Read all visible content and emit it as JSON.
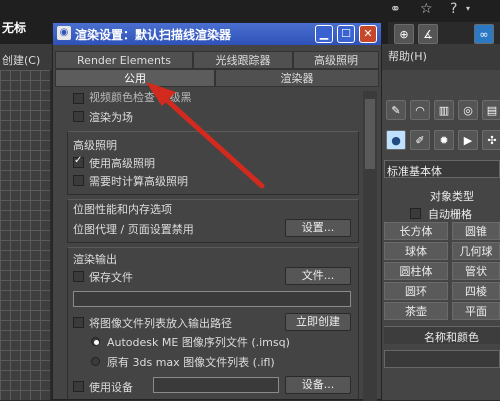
{
  "app": {
    "title_left": "无标",
    "menu_left": "创建(C)",
    "help_menu": "帮助(H)",
    "right_panel": {
      "dropdown_value": "标准基本体",
      "object_type_title": "对象类型",
      "autogrid_label": "自动栅格",
      "buttons": [
        [
          "长方体",
          "圆锥"
        ],
        [
          "球体",
          "几何球"
        ],
        [
          "圆柱体",
          "管状"
        ],
        [
          "圆环",
          "四棱"
        ],
        [
          "茶壶",
          "平面"
        ]
      ],
      "name_color_title": "名称和颜色"
    }
  },
  "dialog": {
    "title": "渲染设置：默认扫描线渲染器",
    "tabs_row1": [
      "Render Elements",
      "光线跟踪器",
      "高级照明"
    ],
    "tabs_row2": [
      "公用",
      "渲染器"
    ],
    "partial_top_text": "视频颜色检查      超级黑",
    "render_to_fields": "渲染为场",
    "adv_lighting": {
      "title": "高级照明",
      "use": "使用高级照明",
      "compute": "需要时计算高级照明"
    },
    "bitmap": {
      "title": "位图性能和内存选项",
      "proxy": "位图代理 / 页面设置禁用",
      "setup_btn": "设置..."
    },
    "render_output": {
      "title": "渲染输出",
      "save_file": "保存文件",
      "file_btn": "文件...",
      "put_list": "将图像文件列表放入输出路径",
      "create_now": "立即创建",
      "autodesk_me": "Autodesk ME 图像序列文件 (.imsq)",
      "legacy": "原有 3ds max 图像文件列表 (.ifl)",
      "use_device": "使用设备",
      "device_btn": "设备..."
    }
  },
  "colors": {
    "title_bar": "#2f52b8",
    "close": "#c7472b",
    "arrow": "#d22a1e"
  }
}
